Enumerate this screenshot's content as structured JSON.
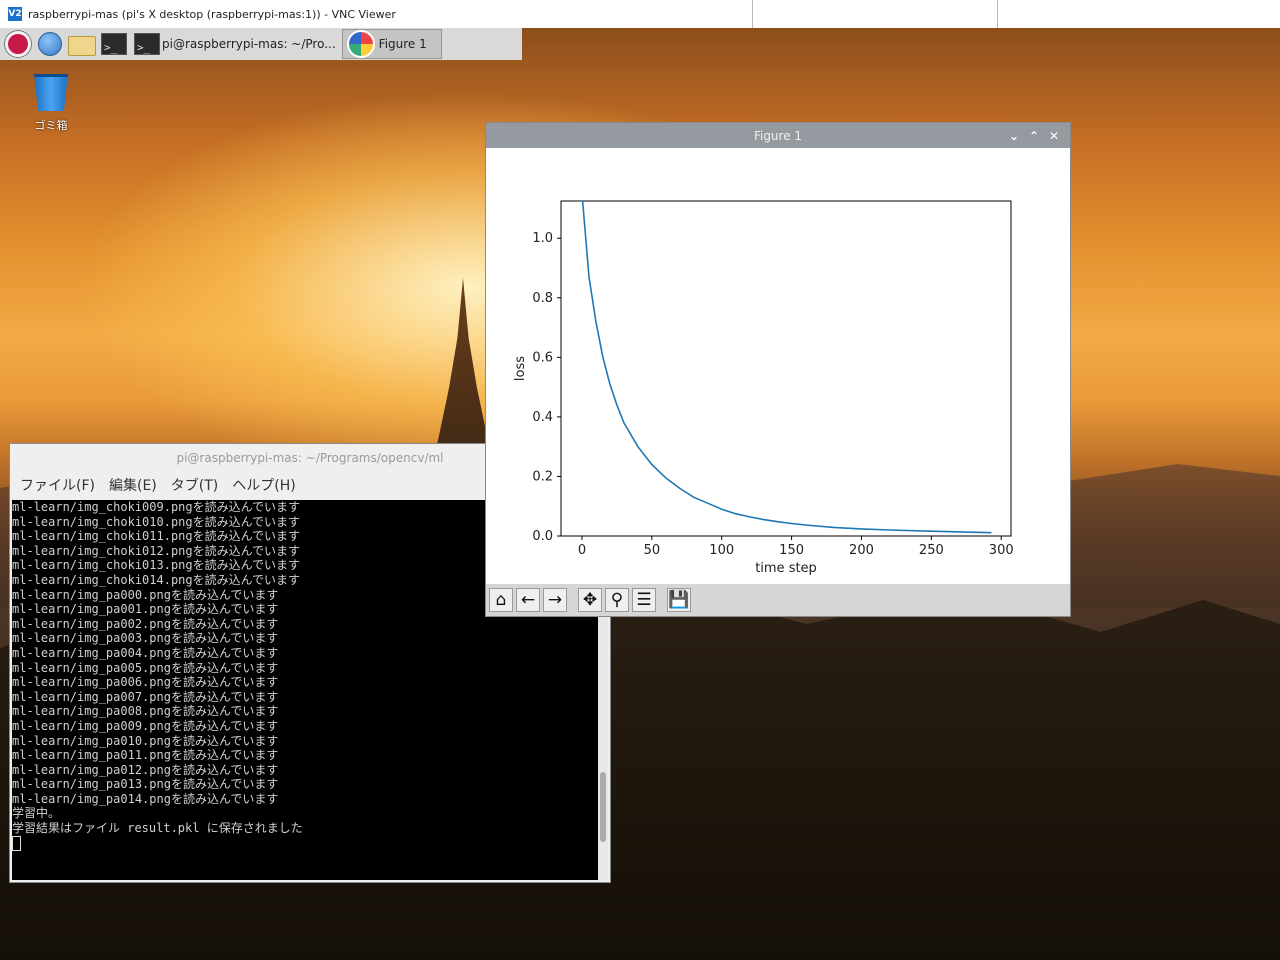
{
  "vnc": {
    "title": "raspberrypi-mas (pi's X desktop (raspberrypi-mas:1)) - VNC Viewer",
    "app_icon_text": "V2"
  },
  "taskbar": {
    "icons": [
      "raspberry-pi-menu",
      "web-browser",
      "file-manager",
      "terminal"
    ],
    "tasks": [
      {
        "label": "pi@raspberrypi-mas: ~/Pro...",
        "icon": "terminal"
      },
      {
        "label": "Figure 1",
        "icon": "matplotlib",
        "active": true
      }
    ]
  },
  "desktop": {
    "trash_label": "ゴミ箱"
  },
  "terminal": {
    "title": "pi@raspberrypi-mas: ~/Programs/opencv/ml",
    "menus": [
      "ファイル(F)",
      "編集(E)",
      "タブ(T)",
      "ヘルプ(H)"
    ],
    "lines": [
      "ml-learn/img_choki009.pngを読み込んでいます",
      "ml-learn/img_choki010.pngを読み込んでいます",
      "ml-learn/img_choki011.pngを読み込んでいます",
      "ml-learn/img_choki012.pngを読み込んでいます",
      "ml-learn/img_choki013.pngを読み込んでいます",
      "ml-learn/img_choki014.pngを読み込んでいます",
      "ml-learn/img_pa000.pngを読み込んでいます",
      "ml-learn/img_pa001.pngを読み込んでいます",
      "ml-learn/img_pa002.pngを読み込んでいます",
      "ml-learn/img_pa003.pngを読み込んでいます",
      "ml-learn/img_pa004.pngを読み込んでいます",
      "ml-learn/img_pa005.pngを読み込んでいます",
      "ml-learn/img_pa006.pngを読み込んでいます",
      "ml-learn/img_pa007.pngを読み込んでいます",
      "ml-learn/img_pa008.pngを読み込んでいます",
      "ml-learn/img_pa009.pngを読み込んでいます",
      "ml-learn/img_pa010.pngを読み込んでいます",
      "ml-learn/img_pa011.pngを読み込んでいます",
      "ml-learn/img_pa012.pngを読み込んでいます",
      "ml-learn/img_pa013.pngを読み込んでいます",
      "ml-learn/img_pa014.pngを読み込んでいます",
      "学習中。",
      "学習結果はファイル result.pkl に保存されました"
    ]
  },
  "figure": {
    "title": "Figure 1",
    "controls": [
      "minimize",
      "maximize",
      "close"
    ],
    "toolbar": [
      "home",
      "back",
      "forward",
      "pan",
      "zoom",
      "configure-subplots",
      "save"
    ]
  },
  "chart_data": {
    "type": "line",
    "title": "",
    "xlabel": "time step",
    "ylabel": "loss",
    "xlim": [
      -15,
      307
    ],
    "ylim": [
      0,
      1.125
    ],
    "xticks": [
      0,
      50,
      100,
      150,
      200,
      250,
      300
    ],
    "yticks": [
      "0.0",
      "0.2",
      "0.4",
      "0.6",
      "0.8",
      "1.0"
    ],
    "grid": false,
    "line_color": "#1f77b4",
    "x": [
      0,
      5,
      10,
      15,
      20,
      25,
      30,
      40,
      50,
      60,
      70,
      80,
      90,
      100,
      110,
      120,
      130,
      140,
      150,
      160,
      180,
      200,
      220,
      250,
      275,
      293
    ],
    "y": [
      1.15,
      0.87,
      0.72,
      0.6,
      0.51,
      0.44,
      0.38,
      0.3,
      0.24,
      0.195,
      0.16,
      0.13,
      0.11,
      0.09,
      0.075,
      0.064,
      0.055,
      0.048,
      0.042,
      0.037,
      0.029,
      0.024,
      0.02,
      0.016,
      0.013,
      0.011
    ]
  }
}
